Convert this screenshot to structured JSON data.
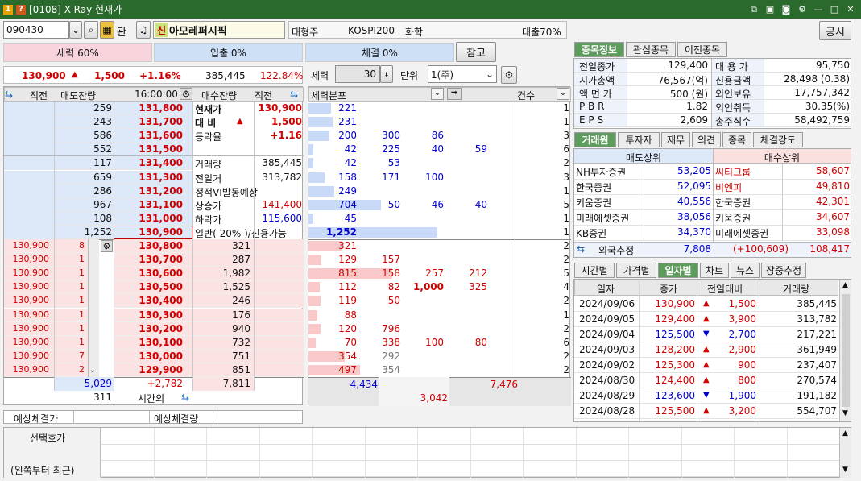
{
  "window": {
    "badge1": "1",
    "badge2": "?",
    "title": "[0108] X-Ray 현재가"
  },
  "toolbar": {
    "code": "090430",
    "name_badge": "신",
    "name": "아모레퍼시픽",
    "gwan": "관",
    "category1": "대형주",
    "category2": "KOSPI200",
    "category3": "화학",
    "loan": "대출70%",
    "notice_button": "공시"
  },
  "strength": {
    "seryeok": "세력 60%",
    "ipchul": "입출 0%",
    "chegyeol": "체결 0%",
    "ref_button": "참고"
  },
  "price_bar": {
    "price": "130,900",
    "arrow": "▲",
    "change": "1,500",
    "pct": "+1.16%",
    "volume": "385,445",
    "ratio": "122.84%"
  },
  "seryeok_ctrl": {
    "label": "세력",
    "value": "30",
    "unit_label": "단위",
    "unit_value": "1(주)"
  },
  "orderbook": {
    "headers": [
      "직전",
      "매도잔량",
      "16:00:00",
      "매수잔량",
      "직전"
    ],
    "ask_qty": [
      "259",
      "243",
      "586",
      "552",
      "117",
      "659",
      "286",
      "967",
      "108",
      "1,252"
    ],
    "ask_price": [
      "131,800",
      "131,700",
      "131,600",
      "131,500",
      "131,400",
      "131,300",
      "131,200",
      "131,100",
      "131,000",
      "130,900"
    ],
    "bid_price": [
      "130,800",
      "130,700",
      "130,600",
      "130,500",
      "130,400",
      "130,300",
      "130,200",
      "130,100",
      "130,000",
      "129,900"
    ],
    "bid_qty": [
      "321",
      "287",
      "1,982",
      "1,525",
      "246",
      "176",
      "940",
      "732",
      "751",
      "851"
    ],
    "ticks_price": [
      "130,900",
      "130,900",
      "130,900",
      "130,900",
      "130,900",
      "130,900",
      "130,900",
      "130,900",
      "130,900",
      "130,900"
    ],
    "ticks_qty": [
      "8",
      "1",
      "1",
      "1",
      "1",
      "1",
      "1",
      "1",
      "7",
      "2"
    ],
    "total_ask": "5,029",
    "net": "+2,782",
    "total_bid": "7,811",
    "after": "311",
    "after_label": "시간외",
    "info": [
      {
        "k": "현재가",
        "v": "130,900"
      },
      {
        "k": "대 비",
        "a": "▲",
        "v": "1,500"
      },
      {
        "k": "등락율",
        "v": "+1.16"
      },
      {
        "k": "",
        "v": ""
      },
      {
        "k": "거래량",
        "v": "385,445"
      },
      {
        "k": "전일거",
        "v": "313,782"
      },
      {
        "k": "정적VI발동예상",
        "v": ""
      },
      {
        "k": "상승가",
        "v": "141,400"
      },
      {
        "k": "하락가",
        "v": "115,600"
      },
      {
        "k": "일반( 20% )/신용가능",
        "v": ""
      }
    ],
    "expect_price_label": "예상체결가",
    "expect_qty_label": "예상체결량"
  },
  "dist": {
    "header": "세력분포",
    "count_header": "건수",
    "ask_rows": [
      [
        "221",
        "",
        "",
        "",
        ""
      ],
      [
        "231",
        "",
        "",
        "",
        ""
      ],
      [
        "200",
        "300",
        "86",
        "",
        ""
      ],
      [
        "42",
        "225",
        "40",
        "59",
        ""
      ],
      [
        "42",
        "53",
        "",
        "",
        ""
      ],
      [
        "158",
        "171",
        "100",
        "",
        ""
      ],
      [
        "249",
        "",
        "",
        "",
        ""
      ],
      [
        "704",
        "50",
        "46",
        "40",
        ""
      ],
      [
        "45",
        "",
        "",
        "",
        ""
      ],
      [
        "1,252",
        "",
        "",
        "",
        ""
      ]
    ],
    "ask_counts": [
      "1",
      "1",
      "3",
      "6",
      "2",
      "3",
      "1",
      "5",
      "1",
      "1"
    ],
    "bid_rows": [
      [
        "321",
        "",
        "",
        "",
        ""
      ],
      [
        "129",
        "157",
        "",
        "",
        ""
      ],
      [
        "815",
        "158",
        "257",
        "212",
        ""
      ],
      [
        "112",
        "82",
        "1,000",
        "325",
        ""
      ],
      [
        "119",
        "50",
        "",
        "",
        ""
      ],
      [
        "88",
        "",
        "",
        "",
        ""
      ],
      [
        "120",
        "796",
        "",
        "",
        ""
      ],
      [
        "70",
        "338",
        "100",
        "80",
        ""
      ],
      [
        "354",
        "292",
        "",
        "",
        ""
      ],
      [
        "497",
        "354",
        "",
        "",
        ""
      ]
    ],
    "bid_counts": [
      "2",
      "2",
      "5",
      "4",
      "2",
      "1",
      "2",
      "6",
      "2",
      "2"
    ],
    "sum_ask": "4,434",
    "sum_bid": "7,476",
    "sum_total": "3,042"
  },
  "info_tabs": [
    "종목정보",
    "관심종목",
    "이전종목"
  ],
  "info_table": [
    {
      "k1": "전일종가",
      "v1": "129,400",
      "k2": "대 용 가",
      "v2": "95,750"
    },
    {
      "k1": "시가총액",
      "v1": "76,567(억)",
      "k2": "신용금액",
      "v2": "28,498  (0.38)"
    },
    {
      "k1": "액 면 가",
      "v1": "500 (원)",
      "k2": "외인보유",
      "v2": "17,757,342"
    },
    {
      "k1": "P B R",
      "v1": "1.82",
      "k2": "외인취득",
      "v2": "30.35(%)"
    },
    {
      "k1": "E P S",
      "v1": "2,609",
      "k2": "총주식수",
      "v2": "58,492,759"
    }
  ],
  "broker_tabs": [
    "거래원",
    "투자자",
    "재무",
    "의견",
    "종목",
    "체결강도"
  ],
  "broker": {
    "sell_header": "매도상위",
    "buy_header": "매수상위",
    "rows": [
      {
        "s": "NH투자증권",
        "sv": "53,205",
        "b": "씨티그룹",
        "bv": "58,607"
      },
      {
        "s": "한국증권",
        "sv": "52,095",
        "b": "비엔피",
        "bv": "49,810"
      },
      {
        "s": "키움증권",
        "sv": "40,556",
        "b": "한국증권",
        "bv": "42,301"
      },
      {
        "s": "미래에셋증권",
        "sv": "38,056",
        "b": "키움증권",
        "bv": "34,607"
      },
      {
        "s": "KB증권",
        "sv": "34,370",
        "b": "미래에셋증권",
        "bv": "33,098"
      }
    ],
    "foreign_label": "외국추정",
    "foreign_sell": "7,808",
    "foreign_diff": "(+100,609)",
    "foreign_buy": "108,417"
  },
  "daily_tabs": [
    "시간별",
    "가격별",
    "일자별",
    "차트",
    "뉴스",
    "장중추정"
  ],
  "daily": {
    "headers": [
      "일자",
      "종가",
      "전일대비",
      "거래량"
    ],
    "rows": [
      {
        "d": "2024/09/06",
        "p": "130,900",
        "a": "▲",
        "c": "1,500",
        "v": "385,445"
      },
      {
        "d": "2024/09/05",
        "p": "129,400",
        "a": "▲",
        "c": "3,900",
        "v": "313,782"
      },
      {
        "d": "2024/09/04",
        "p": "125,500",
        "a": "▼",
        "c": "2,700",
        "v": "217,221"
      },
      {
        "d": "2024/09/03",
        "p": "128,200",
        "a": "▲",
        "c": "2,900",
        "v": "361,949"
      },
      {
        "d": "2024/09/02",
        "p": "125,300",
        "a": "▲",
        "c": "900",
        "v": "237,407"
      },
      {
        "d": "2024/08/30",
        "p": "124,400",
        "a": "▲",
        "c": "800",
        "v": "270,574"
      },
      {
        "d": "2024/08/29",
        "p": "123,600",
        "a": "▼",
        "c": "1,900",
        "v": "191,182"
      },
      {
        "d": "2024/08/28",
        "p": "125,500",
        "a": "▲",
        "c": "3,200",
        "v": "554,707"
      }
    ]
  },
  "bottom": {
    "label1": "선택호가",
    "label2": "(왼쪽부터 최근)"
  },
  "colors": {
    "title_green": "#2a6b2d",
    "up_red": "#d00000",
    "down_blue": "#0000cc",
    "ask_blue": "#dde8f8",
    "bid_pink": "#fbe3e3"
  }
}
